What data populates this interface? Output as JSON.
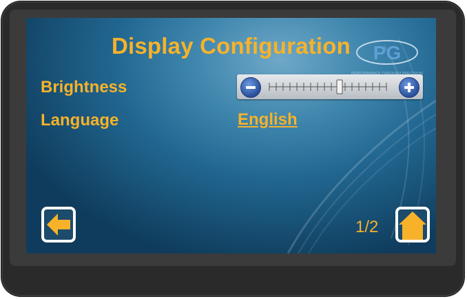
{
  "screen": {
    "title": "Display Configuration",
    "logo_text": "PG",
    "logo_tagline": "PERFORMANCE THROUGH PRECISION"
  },
  "settings": {
    "brightness": {
      "label": "Brightness",
      "level": 0.6
    },
    "language": {
      "label": "Language",
      "value": "English"
    }
  },
  "navigation": {
    "page_indicator": "1/2",
    "back_icon": "arrow-left-icon",
    "home_icon": "home-icon"
  },
  "colors": {
    "accent": "#f7b22a",
    "button_blue": "#2a4f9a"
  }
}
